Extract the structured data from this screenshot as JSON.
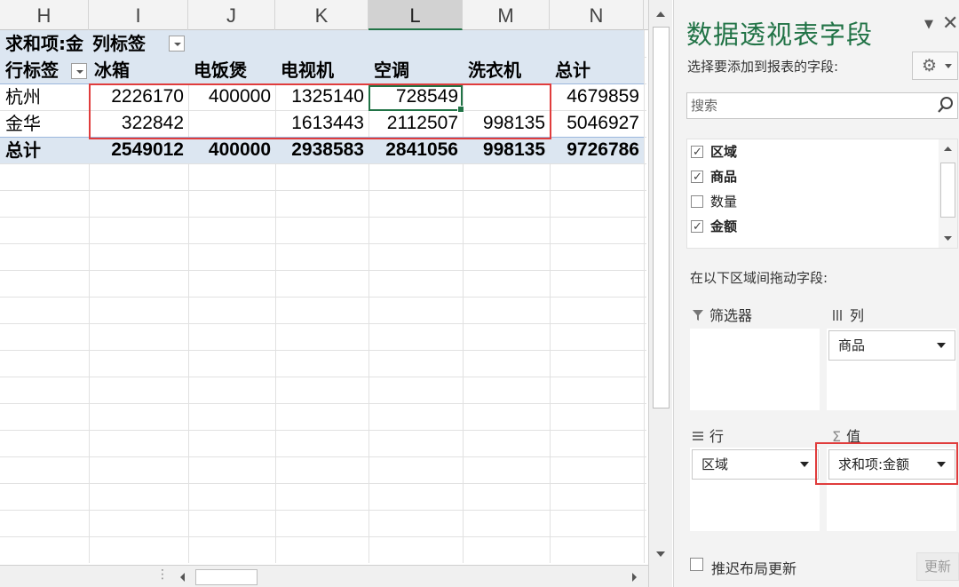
{
  "sheet": {
    "columns": [
      {
        "label": "H",
        "selected": false
      },
      {
        "label": "I",
        "selected": false
      },
      {
        "label": "J",
        "selected": false
      },
      {
        "label": "K",
        "selected": false
      },
      {
        "label": "L",
        "selected": true
      },
      {
        "label": "M",
        "selected": false
      },
      {
        "label": "N",
        "selected": false
      }
    ],
    "pivot": {
      "value_field_label": "求和项:金",
      "column_labels": "列标签",
      "row_labels": "行标签",
      "column_headers": [
        "冰箱",
        "电饭煲",
        "电视机",
        "空调",
        "洗衣机",
        "总计"
      ],
      "rows": [
        {
          "label": "杭州",
          "values": [
            "2226170",
            "400000",
            "1325140",
            "728549",
            "",
            "4679859"
          ]
        },
        {
          "label": "金华",
          "values": [
            "322842",
            "",
            "1613443",
            "2112507",
            "998135",
            "5046927"
          ]
        }
      ],
      "total": {
        "label": "总计",
        "values": [
          "2549012",
          "400000",
          "2938583",
          "2841056",
          "998135",
          "9726786"
        ]
      }
    },
    "active_cell": "L",
    "highlight_color": "#e03c3c",
    "accent_color": "#217346",
    "band_color": "#dce6f1"
  },
  "pane": {
    "title": "数据透视表字段",
    "menu_icon": "chevron-down-icon",
    "close_icon": "close-icon",
    "choose_fields_label": "选择要添加到报表的字段:",
    "gear_icon": "gear-icon",
    "search_placeholder": "搜索",
    "fields": [
      {
        "label": "区域",
        "checked": true
      },
      {
        "label": "商品",
        "checked": true
      },
      {
        "label": "数量",
        "checked": false
      },
      {
        "label": "金额",
        "checked": true
      }
    ],
    "drag_label": "在以下区域间拖动字段:",
    "areas": {
      "filters": {
        "label": "筛选器",
        "icon": "filter-icon",
        "items": []
      },
      "columns": {
        "label": "列",
        "icon": "columns-icon",
        "items": [
          "商品"
        ]
      },
      "rows": {
        "label": "行",
        "icon": "rows-icon",
        "items": [
          "区域"
        ]
      },
      "values": {
        "label": "值",
        "icon": "sigma-icon",
        "items": [
          "求和项:金额"
        ]
      }
    },
    "defer_label": "推迟布局更新",
    "defer_checked": false,
    "update_label": "更新"
  }
}
